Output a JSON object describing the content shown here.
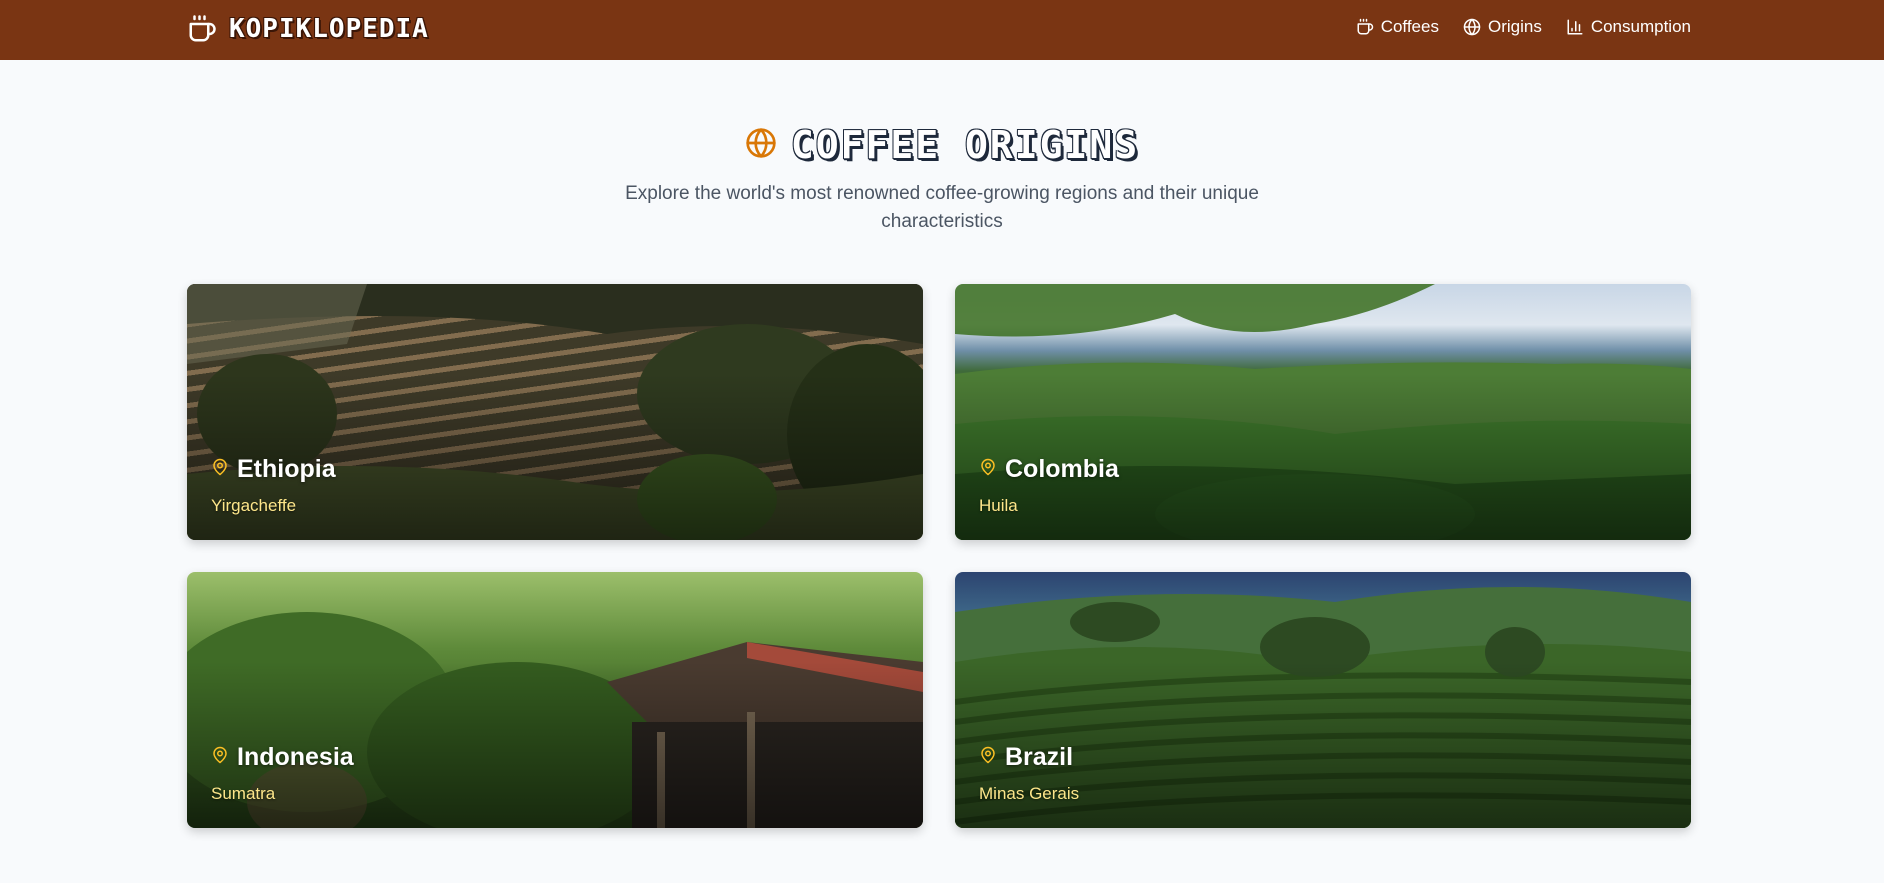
{
  "brand": {
    "name": "KOPIKLOPEDIA",
    "icon": "coffee-cup-icon"
  },
  "nav": {
    "links": [
      {
        "label": "Coffees",
        "icon": "coffee-cup-icon"
      },
      {
        "label": "Origins",
        "icon": "globe-icon"
      },
      {
        "label": "Consumption",
        "icon": "bar-chart-icon"
      }
    ]
  },
  "hero": {
    "icon": "globe-icon",
    "title": "COFFEE ORIGINS",
    "subtitle": "Explore the world's most renowned coffee-growing regions and their unique characteristics"
  },
  "origins": [
    {
      "country": "Ethiopia",
      "region": "Yirgacheffe",
      "icon": "map-pin-icon"
    },
    {
      "country": "Colombia",
      "region": "Huila",
      "icon": "map-pin-icon"
    },
    {
      "country": "Indonesia",
      "region": "Sumatra",
      "icon": "map-pin-icon"
    },
    {
      "country": "Brazil",
      "region": "Minas Gerais",
      "icon": "map-pin-icon"
    }
  ],
  "colors": {
    "navbar": "#7a3513",
    "accent": "#d97706",
    "pin": "#fbbf24",
    "region_text": "#fde68a",
    "page_bg": "#f8fafc"
  }
}
